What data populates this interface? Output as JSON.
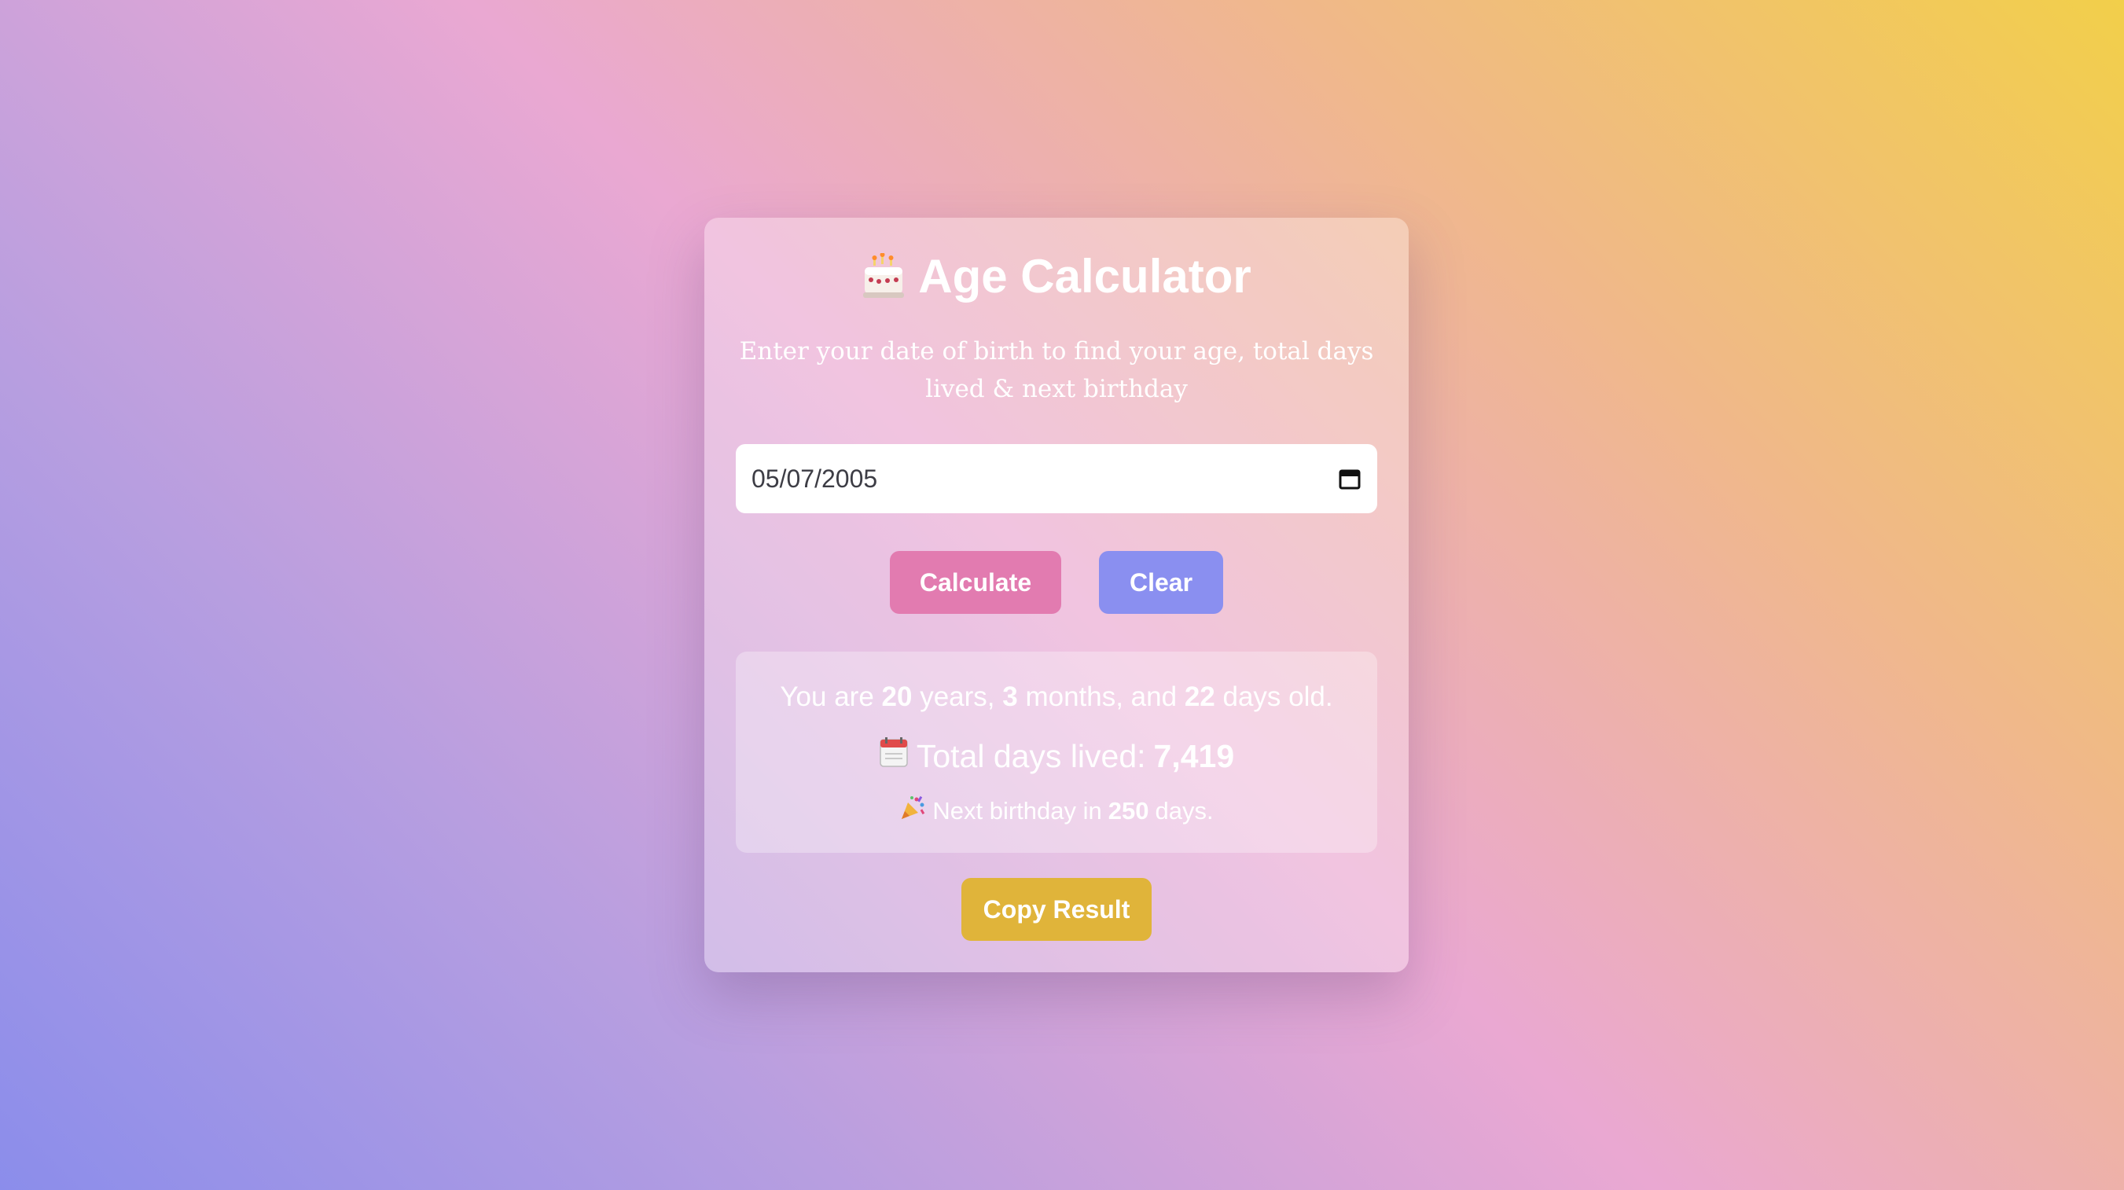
{
  "header": {
    "icon": "birthday-cake-icon",
    "title": "Age Calculator",
    "subtitle": "Enter your date of birth to find your age, total days lived & next birthday"
  },
  "birth_date_input": {
    "value": "05/07/2005",
    "icon": "calendar-icon"
  },
  "actions": {
    "calculate_label": "Calculate",
    "clear_label": "Clear",
    "copy_label": "Copy Result"
  },
  "result": {
    "age": {
      "prefix": "You are",
      "years": "20",
      "years_unit": "years,",
      "months": "3",
      "months_unit": "months, and",
      "days": "22",
      "days_unit": "days old."
    },
    "total_days": {
      "icon": "calendar-page-icon",
      "label": "Total days lived:",
      "value": "7,419"
    },
    "next_birthday": {
      "icon": "party-popper-icon",
      "prefix": "Next birthday in",
      "value": "250",
      "suffix": "days."
    }
  },
  "colors": {
    "calculate_button": "#e27bb0",
    "clear_button": "#8a8ff0",
    "copy_button": "#e0b43a"
  }
}
